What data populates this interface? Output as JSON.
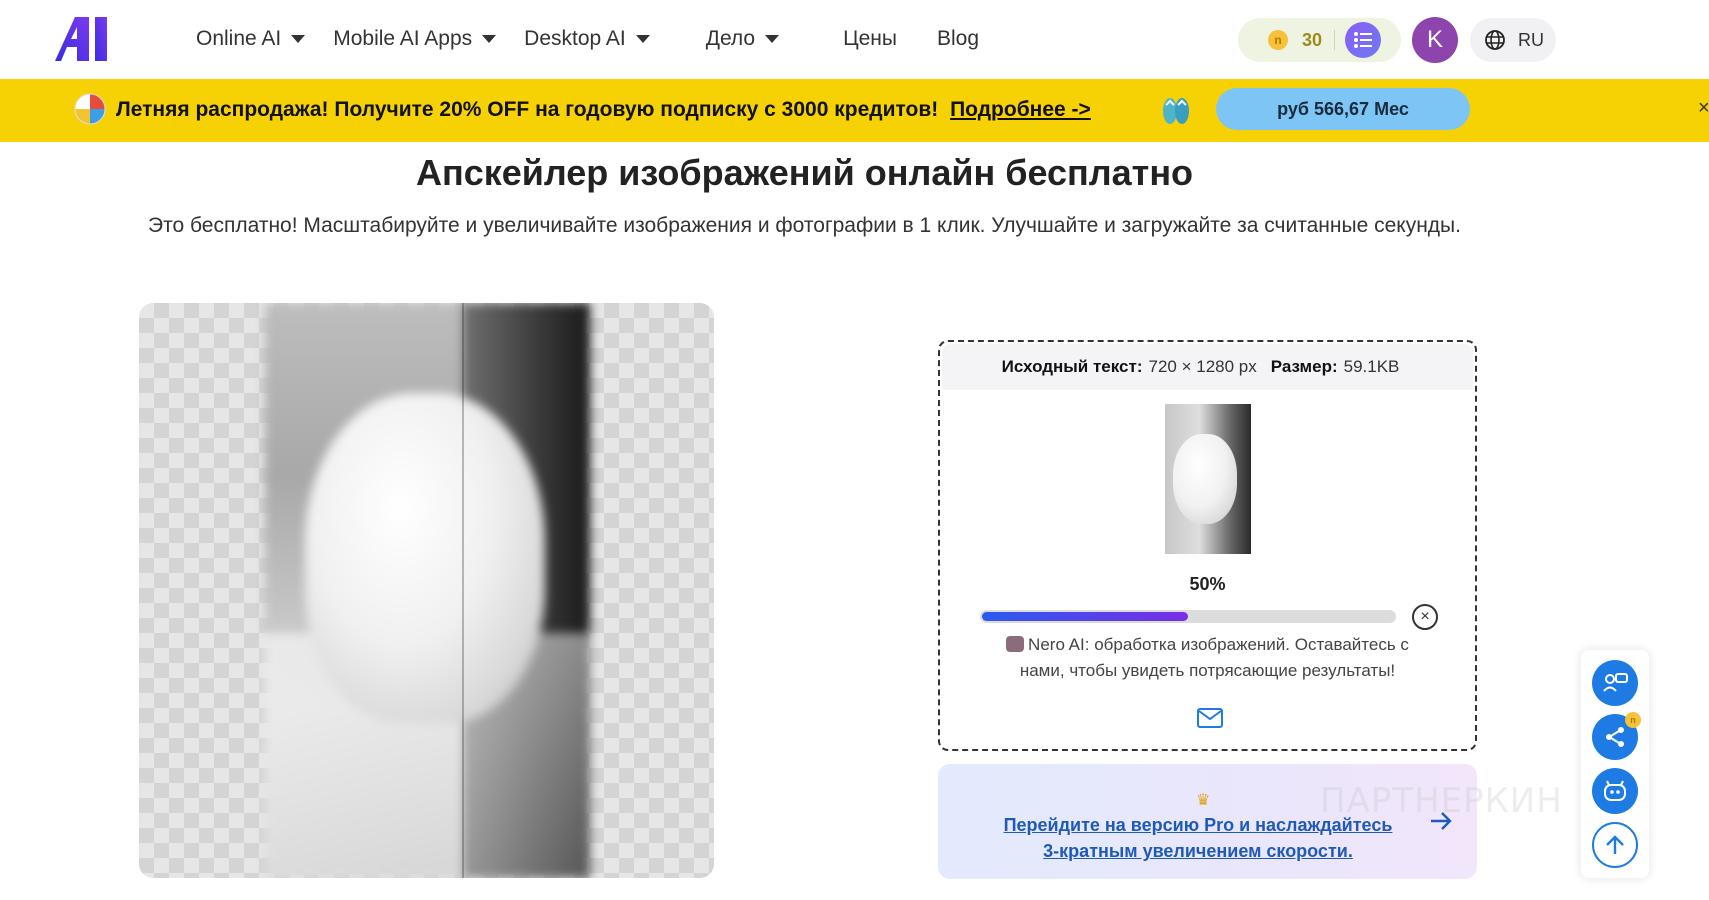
{
  "header": {
    "nav": [
      {
        "label": "Online AI",
        "has_dropdown": true
      },
      {
        "label": "Mobile AI Apps",
        "has_dropdown": true
      },
      {
        "label": "Desktop AI",
        "has_dropdown": true
      },
      {
        "label": "Дело",
        "has_dropdown": true
      }
    ],
    "links": [
      "Цены",
      "Blog"
    ],
    "credits": "30",
    "coin_symbol": "n",
    "avatar_letter": "K",
    "language": "RU"
  },
  "banner": {
    "text": "Летняя распродажа! Получите 20% OFF на годовую подписку с 3000 кредитов!",
    "link": "Подробнее ->",
    "price_button": "руб 566,67 Мес",
    "close": "×",
    "background": "#f6d205"
  },
  "main": {
    "title": "Апскейлер изображений онлайн бесплатно",
    "subtitle": "Это бесплатно! Масштабируйте и увеличивайте изображения и фотографии в 1 клик. Улучшайте и загружайте за считанные секунды."
  },
  "card": {
    "source_label": "Исходный текст:",
    "source_value": "720 × 1280 px",
    "size_label": "Размер:",
    "size_value": "59.1KB",
    "progress_text": "50%",
    "progress_fraction": 0.5,
    "cancel_glyph": "×",
    "message": "Nero AI: обработка изображений. Оставайтесь с нами, чтобы увидеть потрясающие результаты!"
  },
  "pro": {
    "crown": "♛",
    "link": "Перейдите на версию Pro и наслаждайтесь 3-кратным увеличением скорости."
  },
  "side_toolbar": {
    "badge": "n"
  },
  "watermark": "ПАРТНЕРКИН",
  "icons": {
    "logo": "logo-icon",
    "caret": "caret-down-icon",
    "coin": "coin-icon",
    "tasks": "task-list-icon",
    "globe": "globe-icon",
    "ball": "beach-ball-icon",
    "flipflop": "flip-flops-icon",
    "cancel": "close-circle-icon",
    "mail": "mail-icon",
    "arrow": "arrow-right-icon",
    "feedback": "feedback-icon",
    "share": "share-icon",
    "robot": "robot-icon",
    "scroll_top": "arrow-up-icon"
  },
  "colors": {
    "accent": "#1e7be3",
    "banner": "#f6d205",
    "price_button": "#7dc5f5",
    "progress_start": "#2a5bf0",
    "progress_end": "#7a2ee6",
    "avatar": "#8e44ad"
  }
}
